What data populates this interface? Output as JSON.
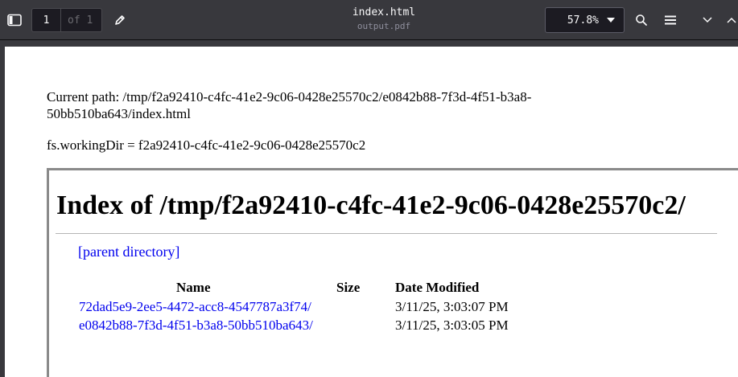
{
  "toolbar": {
    "sidebar_toggle_icon": "sidebar-icon",
    "page_number": "1",
    "page_of": "of 1",
    "draw_icon": "pen-icon",
    "title": "index.html",
    "subtitle": "output.pdf",
    "zoom_value": "57.8%",
    "search_icon": "search-icon",
    "menu_icon": "hamburger-menu-icon",
    "prev_icon": "chevron-down-icon",
    "next_icon": "chevron-up-icon"
  },
  "document": {
    "current_path": "Current path: /tmp/f2a92410-c4fc-41e2-9c06-0428e25570c2/e0842b88-7f3d-4f51-b3a8-",
    "current_path_cont": "50bb510ba643/index.html",
    "working_dir": "fs.workingDir = f2a92410-c4fc-41e2-9c06-0428e25570c2",
    "index_title": "Index of /tmp/f2a92410-c4fc-41e2-9c06-0428e25570c2/",
    "parent_link": "[parent directory]",
    "columns": {
      "name": "Name",
      "size": "Size",
      "date": "Date Modified"
    },
    "rows": [
      {
        "name": "72dad5e9-2ee5-4472-acc8-4547787a3f74/",
        "size": "",
        "date": "3/11/25, 3:03:07 PM"
      },
      {
        "name": "e0842b88-7f3d-4f51-b3a8-50bb510ba643/",
        "size": "",
        "date": "3/11/25, 3:03:05 PM"
      }
    ]
  },
  "colors": {
    "toolbar_bg": "#38383d",
    "link": "#0000ee",
    "page_bg": "#ffffff"
  }
}
